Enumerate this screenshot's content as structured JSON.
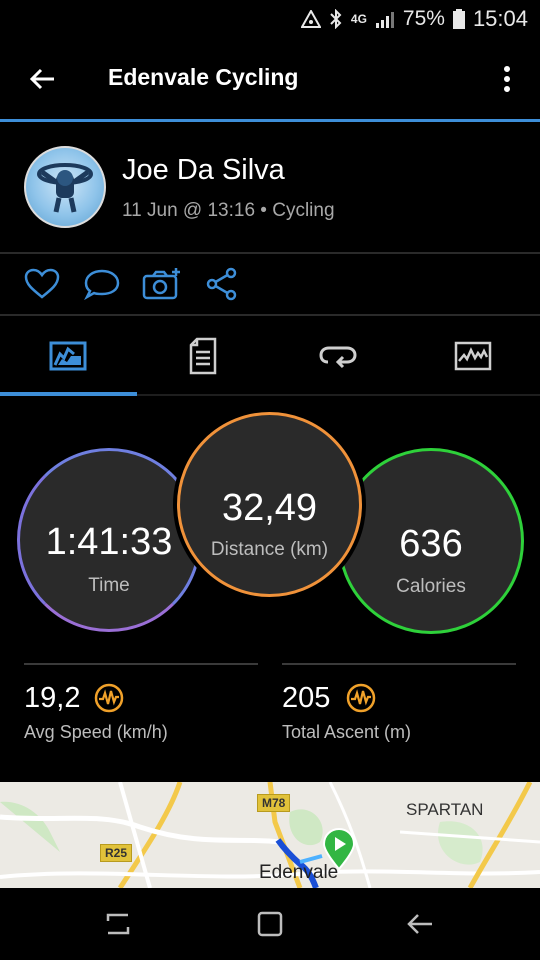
{
  "status_bar": {
    "network": "4G",
    "battery": "75%",
    "time": "15:04"
  },
  "app_bar": {
    "title": "Edenvale Cycling",
    "back_icon": "arrow-left-icon",
    "menu_icon": "more-vertical-icon"
  },
  "activity": {
    "user_name": "Joe Da Silva",
    "meta": "11 Jun @ 13:16 • Cycling"
  },
  "actions": [
    {
      "icon": "heart-icon"
    },
    {
      "icon": "comment-icon"
    },
    {
      "icon": "add-photo-icon"
    },
    {
      "icon": "share-icon"
    }
  ],
  "tabs": [
    {
      "icon": "overview-icon",
      "selected": true
    },
    {
      "icon": "details-icon",
      "selected": false
    },
    {
      "icon": "laps-icon",
      "selected": false
    },
    {
      "icon": "charts-icon",
      "selected": false
    }
  ],
  "summary": {
    "time": {
      "value": "1:41:33",
      "label": "Time"
    },
    "distance": {
      "value": "32,49",
      "label": "Distance (km)"
    },
    "calories": {
      "value": "636",
      "label": "Calories"
    }
  },
  "stats": [
    {
      "value": "19,2",
      "label": "Avg Speed (km/h)",
      "icon": "pulse-badge-icon"
    },
    {
      "value": "205",
      "label": "Total Ascent (m)",
      "icon": "pulse-badge-icon"
    }
  ],
  "map": {
    "labels": [
      "SPARTAN",
      "Edenvale"
    ],
    "road_badges": [
      "M78",
      "R25"
    ]
  },
  "colors": {
    "accent": "#3d8ed8",
    "time_ring": "#6f7fe0",
    "distance_ring": "#f0923a",
    "calories_ring": "#2ed13a",
    "badge_orange": "#f0a12a"
  }
}
